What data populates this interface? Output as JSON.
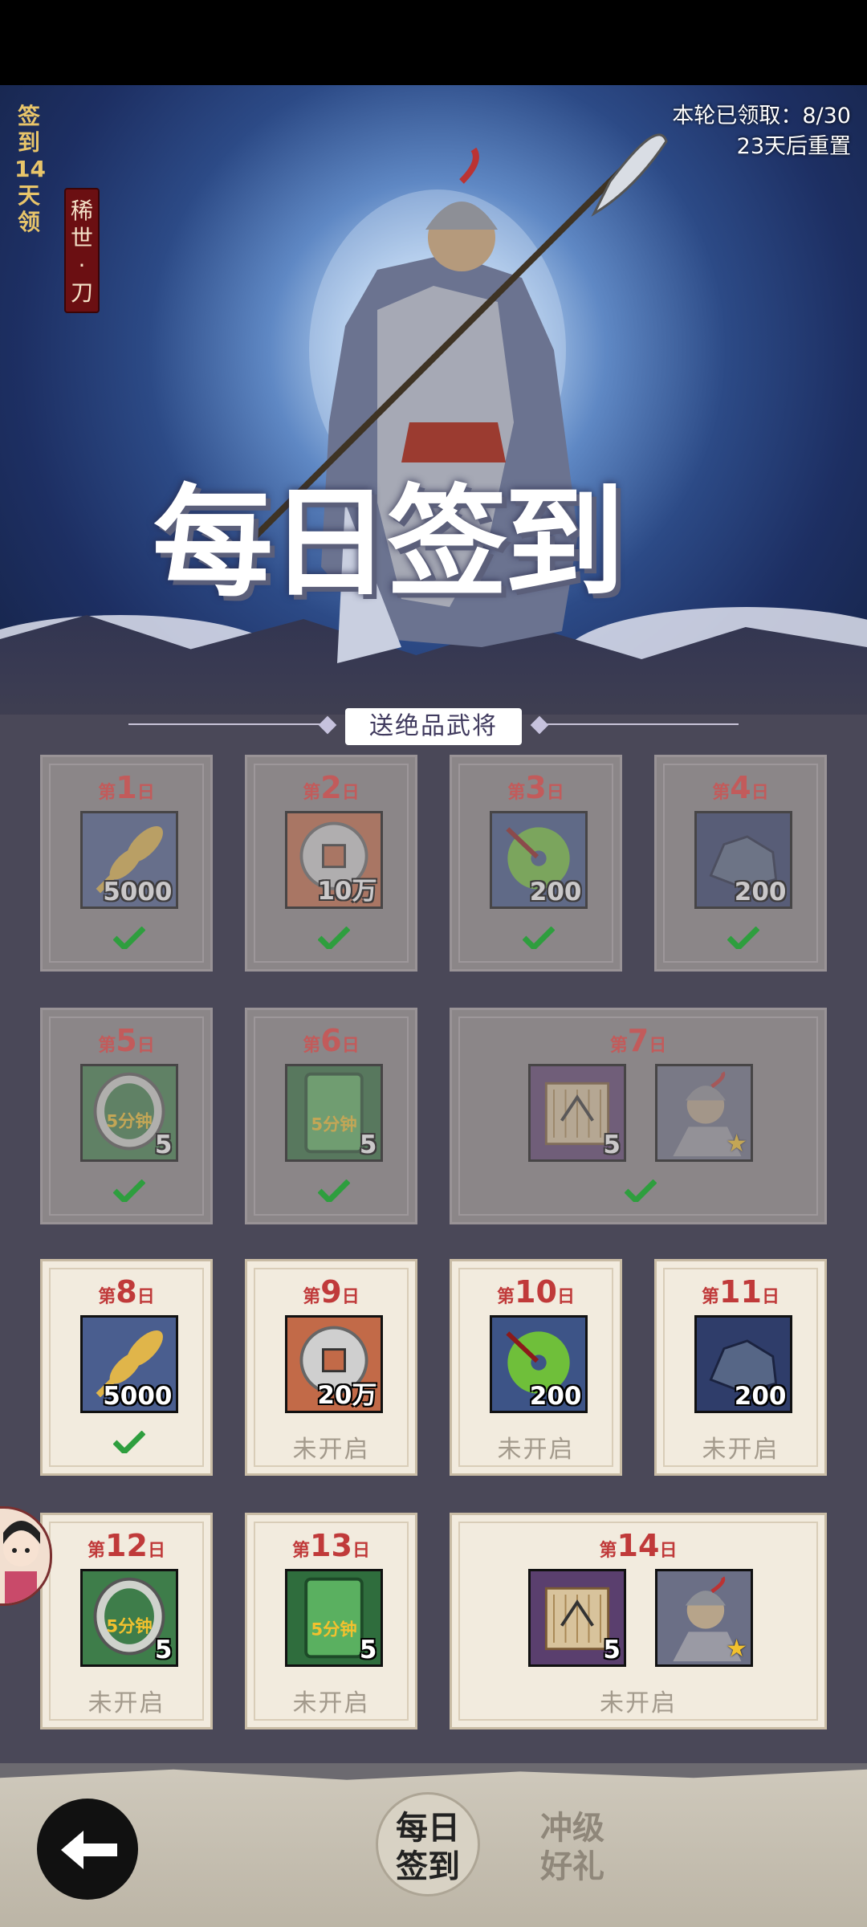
{
  "header": {
    "side_vertical_text": "签\n到\n14\n天\n领",
    "side_badge_text": "稀\n世\n·\n刀",
    "round_claimed": "本轮已领取：8/30",
    "reset_text": "23天后重置",
    "title": "每日签到",
    "subtitle": "送绝品武将"
  },
  "days": [
    {
      "prefix": "第",
      "num": "1",
      "suffix": "日",
      "items": [
        {
          "icon": "wheat-icon",
          "qty": "5000"
        }
      ],
      "state": "claimed"
    },
    {
      "prefix": "第",
      "num": "2",
      "suffix": "日",
      "items": [
        {
          "icon": "coin-icon",
          "qty": "10万"
        }
      ],
      "state": "claimed"
    },
    {
      "prefix": "第",
      "num": "3",
      "suffix": "日",
      "items": [
        {
          "icon": "jade-disc-icon",
          "qty": "200"
        }
      ],
      "state": "claimed"
    },
    {
      "prefix": "第",
      "num": "4",
      "suffix": "日",
      "items": [
        {
          "icon": "ore-icon",
          "qty": "200"
        }
      ],
      "state": "claimed"
    },
    {
      "prefix": "第",
      "num": "5",
      "suffix": "日",
      "items": [
        {
          "icon": "speedup-token-icon",
          "qty": "5",
          "overlay": "5分钟"
        }
      ],
      "state": "claimed"
    },
    {
      "prefix": "第",
      "num": "6",
      "suffix": "日",
      "items": [
        {
          "icon": "speedup-card-icon",
          "qty": "5",
          "overlay": "5分钟"
        }
      ],
      "state": "claimed"
    },
    {
      "prefix": "第",
      "num": "7",
      "suffix": "日",
      "items": [
        {
          "icon": "scroll-icon",
          "qty": "5"
        },
        {
          "icon": "general-portrait-icon",
          "qty": ""
        }
      ],
      "state": "claimed"
    },
    {
      "prefix": "第",
      "num": "8",
      "suffix": "日",
      "items": [
        {
          "icon": "wheat-icon",
          "qty": "5000"
        }
      ],
      "state": "today-claimed"
    },
    {
      "prefix": "第",
      "num": "9",
      "suffix": "日",
      "items": [
        {
          "icon": "coin-icon",
          "qty": "20万"
        }
      ],
      "state": "locked"
    },
    {
      "prefix": "第",
      "num": "10",
      "suffix": "日",
      "items": [
        {
          "icon": "jade-disc-icon",
          "qty": "200"
        }
      ],
      "state": "locked"
    },
    {
      "prefix": "第",
      "num": "11",
      "suffix": "日",
      "items": [
        {
          "icon": "ore-icon",
          "qty": "200"
        }
      ],
      "state": "locked"
    },
    {
      "prefix": "第",
      "num": "12",
      "suffix": "日",
      "items": [
        {
          "icon": "speedup-token-icon",
          "qty": "5",
          "overlay": "5分钟"
        }
      ],
      "state": "locked"
    },
    {
      "prefix": "第",
      "num": "13",
      "suffix": "日",
      "items": [
        {
          "icon": "speedup-card-icon",
          "qty": "5",
          "overlay": "5分钟"
        }
      ],
      "state": "locked"
    },
    {
      "prefix": "第",
      "num": "14",
      "suffix": "日",
      "items": [
        {
          "icon": "scroll-icon",
          "qty": "5"
        },
        {
          "icon": "general-portrait-icon",
          "qty": ""
        }
      ],
      "state": "locked"
    }
  ],
  "locked_label": "未开启",
  "tabs": [
    {
      "label_line1": "每日",
      "label_line2": "签到",
      "active": true
    },
    {
      "label_line1": "冲级",
      "label_line2": "好礼",
      "active": false
    }
  ],
  "colors": {
    "accent_red": "#c03a3a",
    "check_green": "#2e9e3e",
    "gold": "#e8c56a"
  }
}
